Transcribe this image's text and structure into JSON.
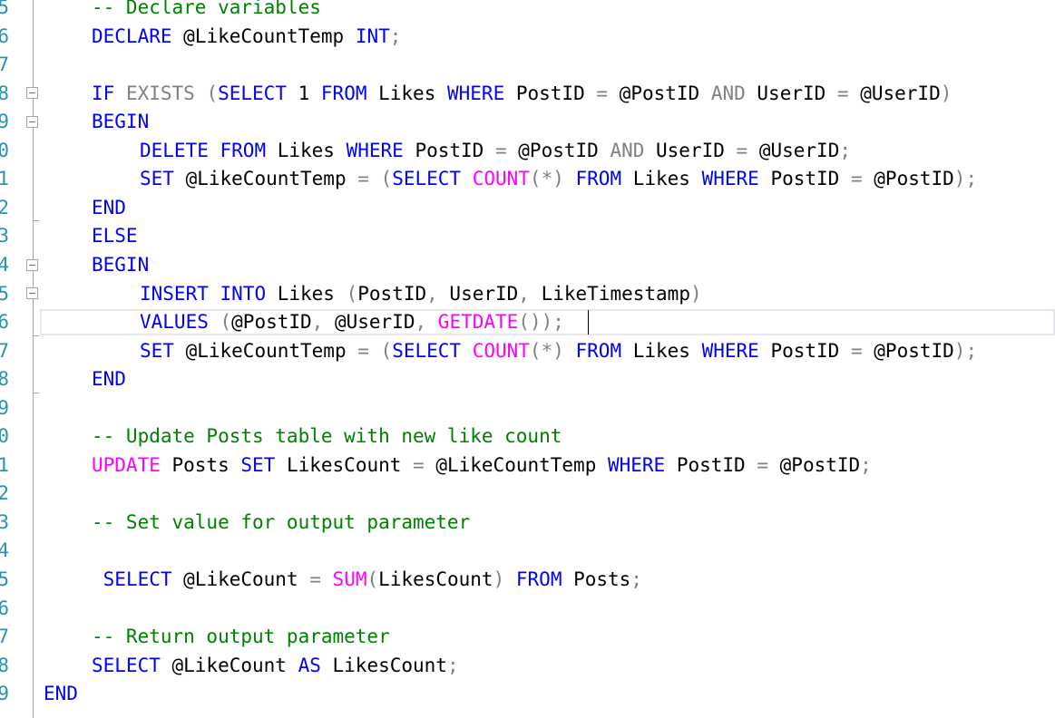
{
  "editor": {
    "lines": [
      {
        "num": "5",
        "indent": 1,
        "tokens": [
          {
            "t": "-- Declare variables",
            "c": "cm"
          }
        ]
      },
      {
        "num": "6",
        "indent": 1,
        "tokens": [
          {
            "t": "DECLARE",
            "c": "kw"
          },
          {
            "t": " @LikeCountTemp ",
            "c": "tx"
          },
          {
            "t": "INT",
            "c": "kw"
          },
          {
            "t": ";",
            "c": "gr"
          }
        ]
      },
      {
        "num": "7",
        "indent": 0,
        "tokens": []
      },
      {
        "num": "8",
        "indent": 1,
        "tokens": [
          {
            "t": "IF",
            "c": "kw"
          },
          {
            "t": " ",
            "c": "tx"
          },
          {
            "t": "EXISTS",
            "c": "gr"
          },
          {
            "t": " (",
            "c": "gr"
          },
          {
            "t": "SELECT",
            "c": "kw"
          },
          {
            "t": " 1 ",
            "c": "tx"
          },
          {
            "t": "FROM",
            "c": "kw"
          },
          {
            "t": " Likes ",
            "c": "tx"
          },
          {
            "t": "WHERE",
            "c": "kw"
          },
          {
            "t": " PostID ",
            "c": "tx"
          },
          {
            "t": "=",
            "c": "gr"
          },
          {
            "t": " @PostID ",
            "c": "tx"
          },
          {
            "t": "AND",
            "c": "gr"
          },
          {
            "t": " UserID ",
            "c": "tx"
          },
          {
            "t": "=",
            "c": "gr"
          },
          {
            "t": " @UserID",
            "c": "tx"
          },
          {
            "t": ")",
            "c": "gr"
          }
        ]
      },
      {
        "num": "9",
        "indent": 1,
        "tokens": [
          {
            "t": "BEGIN",
            "c": "kw"
          }
        ]
      },
      {
        "num": "0",
        "indent": 2,
        "tokens": [
          {
            "t": "DELETE",
            "c": "kw"
          },
          {
            "t": " ",
            "c": "tx"
          },
          {
            "t": "FROM",
            "c": "kw"
          },
          {
            "t": " Likes ",
            "c": "tx"
          },
          {
            "t": "WHERE",
            "c": "kw"
          },
          {
            "t": " PostID ",
            "c": "tx"
          },
          {
            "t": "=",
            "c": "gr"
          },
          {
            "t": " @PostID ",
            "c": "tx"
          },
          {
            "t": "AND",
            "c": "gr"
          },
          {
            "t": " UserID ",
            "c": "tx"
          },
          {
            "t": "=",
            "c": "gr"
          },
          {
            "t": " @UserID",
            "c": "tx"
          },
          {
            "t": ";",
            "c": "gr"
          }
        ]
      },
      {
        "num": "1",
        "indent": 2,
        "tokens": [
          {
            "t": "SET",
            "c": "kw"
          },
          {
            "t": " @LikeCountTemp ",
            "c": "tx"
          },
          {
            "t": "=",
            "c": "gr"
          },
          {
            "t": " (",
            "c": "gr"
          },
          {
            "t": "SELECT",
            "c": "kw"
          },
          {
            "t": " ",
            "c": "tx"
          },
          {
            "t": "COUNT",
            "c": "fn"
          },
          {
            "t": "(*)",
            "c": "gr"
          },
          {
            "t": " ",
            "c": "tx"
          },
          {
            "t": "FROM",
            "c": "kw"
          },
          {
            "t": " Likes ",
            "c": "tx"
          },
          {
            "t": "WHERE",
            "c": "kw"
          },
          {
            "t": " PostID ",
            "c": "tx"
          },
          {
            "t": "=",
            "c": "gr"
          },
          {
            "t": " @PostID",
            "c": "tx"
          },
          {
            "t": ");",
            "c": "gr"
          }
        ]
      },
      {
        "num": "2",
        "indent": 1,
        "tokens": [
          {
            "t": "END",
            "c": "kw"
          }
        ]
      },
      {
        "num": "3",
        "indent": 1,
        "tokens": [
          {
            "t": "ELSE",
            "c": "kw"
          }
        ]
      },
      {
        "num": "4",
        "indent": 1,
        "tokens": [
          {
            "t": "BEGIN",
            "c": "kw"
          }
        ]
      },
      {
        "num": "5",
        "indent": 2,
        "tokens": [
          {
            "t": "INSERT",
            "c": "kw"
          },
          {
            "t": " ",
            "c": "tx"
          },
          {
            "t": "INTO",
            "c": "kw"
          },
          {
            "t": " Likes ",
            "c": "tx"
          },
          {
            "t": "(",
            "c": "gr"
          },
          {
            "t": "PostID",
            "c": "tx"
          },
          {
            "t": ",",
            "c": "gr"
          },
          {
            "t": " UserID",
            "c": "tx"
          },
          {
            "t": ",",
            "c": "gr"
          },
          {
            "t": " LikeTimestamp",
            "c": "tx"
          },
          {
            "t": ")",
            "c": "gr"
          }
        ]
      },
      {
        "num": "6",
        "indent": 2,
        "tokens": [
          {
            "t": "VALUES",
            "c": "kw"
          },
          {
            "t": " (",
            "c": "gr"
          },
          {
            "t": "@PostID",
            "c": "tx"
          },
          {
            "t": ",",
            "c": "gr"
          },
          {
            "t": " @UserID",
            "c": "tx"
          },
          {
            "t": ",",
            "c": "gr"
          },
          {
            "t": " ",
            "c": "tx"
          },
          {
            "t": "GETDATE",
            "c": "fn"
          },
          {
            "t": "());",
            "c": "gr"
          }
        ]
      },
      {
        "num": "7",
        "indent": 2,
        "tokens": [
          {
            "t": "SET",
            "c": "kw"
          },
          {
            "t": " @LikeCountTemp ",
            "c": "tx"
          },
          {
            "t": "=",
            "c": "gr"
          },
          {
            "t": " (",
            "c": "gr"
          },
          {
            "t": "SELECT",
            "c": "kw"
          },
          {
            "t": " ",
            "c": "tx"
          },
          {
            "t": "COUNT",
            "c": "fn"
          },
          {
            "t": "(*)",
            "c": "gr"
          },
          {
            "t": " ",
            "c": "tx"
          },
          {
            "t": "FROM",
            "c": "kw"
          },
          {
            "t": " Likes ",
            "c": "tx"
          },
          {
            "t": "WHERE",
            "c": "kw"
          },
          {
            "t": " PostID ",
            "c": "tx"
          },
          {
            "t": "=",
            "c": "gr"
          },
          {
            "t": " @PostID",
            "c": "tx"
          },
          {
            "t": ");",
            "c": "gr"
          }
        ]
      },
      {
        "num": "8",
        "indent": 1,
        "tokens": [
          {
            "t": "END",
            "c": "kw"
          }
        ]
      },
      {
        "num": "9",
        "indent": 0,
        "tokens": []
      },
      {
        "num": "0",
        "indent": 1,
        "tokens": [
          {
            "t": "-- Update Posts table with new like count",
            "c": "cm"
          }
        ]
      },
      {
        "num": "1",
        "indent": 1,
        "tokens": [
          {
            "t": "UPDATE",
            "c": "fn"
          },
          {
            "t": " Posts ",
            "c": "tx"
          },
          {
            "t": "SET",
            "c": "kw"
          },
          {
            "t": " LikesCount ",
            "c": "tx"
          },
          {
            "t": "=",
            "c": "gr"
          },
          {
            "t": " @LikeCountTemp ",
            "c": "tx"
          },
          {
            "t": "WHERE",
            "c": "kw"
          },
          {
            "t": " PostID ",
            "c": "tx"
          },
          {
            "t": "=",
            "c": "gr"
          },
          {
            "t": " @PostID",
            "c": "tx"
          },
          {
            "t": ";",
            "c": "gr"
          }
        ]
      },
      {
        "num": "2",
        "indent": 0,
        "tokens": []
      },
      {
        "num": "3",
        "indent": 1,
        "tokens": [
          {
            "t": "-- Set value for output parameter",
            "c": "cm"
          }
        ]
      },
      {
        "num": "4",
        "indent": 0,
        "tokens": []
      },
      {
        "num": "5",
        "indent": 1,
        "tokens": [
          {
            "t": " ",
            "c": "tx"
          },
          {
            "t": "SELECT",
            "c": "kw"
          },
          {
            "t": " @LikeCount ",
            "c": "tx"
          },
          {
            "t": "=",
            "c": "gr"
          },
          {
            "t": " ",
            "c": "tx"
          },
          {
            "t": "SUM",
            "c": "fn"
          },
          {
            "t": "(",
            "c": "gr"
          },
          {
            "t": "LikesCount",
            "c": "tx"
          },
          {
            "t": ")",
            "c": "gr"
          },
          {
            "t": " ",
            "c": "tx"
          },
          {
            "t": "FROM",
            "c": "kw"
          },
          {
            "t": " Posts",
            "c": "tx"
          },
          {
            "t": ";",
            "c": "gr"
          }
        ]
      },
      {
        "num": "6",
        "indent": 0,
        "tokens": []
      },
      {
        "num": "7",
        "indent": 1,
        "tokens": [
          {
            "t": "-- Return output parameter",
            "c": "cm"
          }
        ]
      },
      {
        "num": "8",
        "indent": 1,
        "tokens": [
          {
            "t": "SELECT",
            "c": "kw"
          },
          {
            "t": " @LikeCount ",
            "c": "tx"
          },
          {
            "t": "AS",
            "c": "kw"
          },
          {
            "t": " LikesCount",
            "c": "tx"
          },
          {
            "t": ";",
            "c": "gr"
          }
        ]
      },
      {
        "num": "9",
        "indent": 0,
        "tokens": [
          {
            "t": "END",
            "c": "kw"
          }
        ]
      }
    ]
  },
  "icons": {
    "fold_marker": "collapse-minus-icon"
  },
  "colors": {
    "keyword": "#0000ff",
    "function": "#ff00ff",
    "comment": "#008000",
    "operator": "#808080",
    "line_number": "#2b91af"
  }
}
